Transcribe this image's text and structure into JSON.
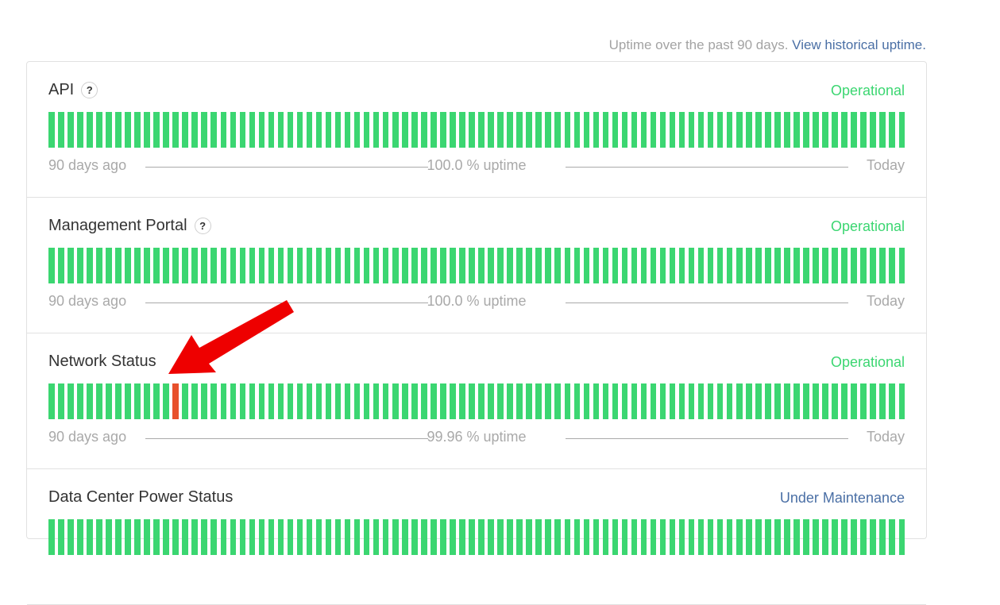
{
  "header": {
    "uptime_text": "Uptime over the past 90 days.",
    "historical_link": "View historical uptime."
  },
  "colors": {
    "operational": "#3bd671",
    "outage": "#e8502c",
    "arrow": "#ee0000"
  },
  "components": [
    {
      "name": "API",
      "has_help": true,
      "help_label": "?",
      "status": "Operational",
      "days": 90,
      "outage_days": [],
      "start_label": "90 days ago",
      "uptime_label": "100.0 % uptime",
      "end_label": "Today"
    },
    {
      "name": "Management Portal",
      "has_help": true,
      "help_label": "?",
      "status": "Operational",
      "days": 90,
      "outage_days": [],
      "start_label": "90 days ago",
      "uptime_label": "100.0 % uptime",
      "end_label": "Today"
    },
    {
      "name": "Network Status",
      "has_help": false,
      "help_label": "",
      "status": "Operational",
      "days": 90,
      "outage_days": [
        13
      ],
      "start_label": "90 days ago",
      "uptime_label": "99.96 % uptime",
      "end_label": "Today"
    },
    {
      "name": "Data Center Power Status",
      "has_help": false,
      "help_label": "",
      "status": "Under Maintenance",
      "days": 90,
      "outage_days": [],
      "start_label": "",
      "uptime_label": "",
      "end_label": ""
    }
  ]
}
